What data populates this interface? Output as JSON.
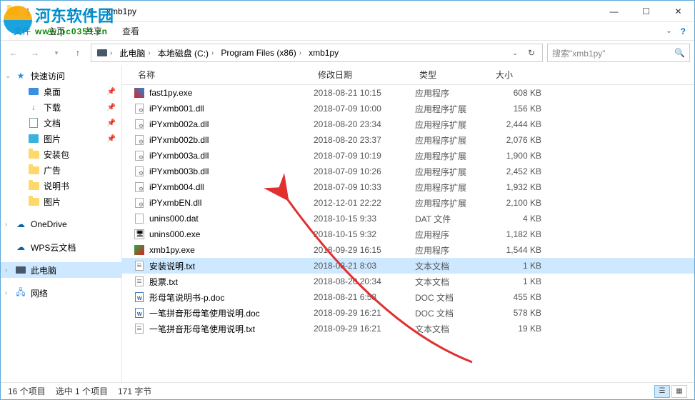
{
  "window": {
    "title": "xmb1py"
  },
  "ribbon": {
    "file": "文件",
    "tabs": [
      "主页",
      "共享",
      "查看"
    ]
  },
  "watermark": {
    "text": "河东软件园",
    "url": "www.pc0359.cn"
  },
  "address": {
    "segments": [
      "此电脑",
      "本地磁盘 (C:)",
      "Program Files (x86)",
      "xmb1py"
    ],
    "search_placeholder": "搜索\"xmb1py\""
  },
  "nav": {
    "quick": "快速访问",
    "desktop": "桌面",
    "downloads": "下载",
    "documents": "文档",
    "pictures": "图片",
    "folders": [
      "安装包",
      "广告",
      "说明书",
      "图片"
    ],
    "onedrive": "OneDrive",
    "wps": "WPS云文档",
    "thispc": "此电脑",
    "network": "网络"
  },
  "cols": {
    "name": "名称",
    "date": "修改日期",
    "type": "类型",
    "size": "大小"
  },
  "files": [
    {
      "ic": "exe1",
      "name": "fast1py.exe",
      "date": "2018-08-21 10:15",
      "type": "应用程序",
      "size": "608 KB"
    },
    {
      "ic": "dll",
      "name": "iPYxmb001.dll",
      "date": "2018-07-09 10:00",
      "type": "应用程序扩展",
      "size": "156 KB"
    },
    {
      "ic": "dll",
      "name": "iPYxmb002a.dll",
      "date": "2018-08-20 23:34",
      "type": "应用程序扩展",
      "size": "2,444 KB"
    },
    {
      "ic": "dll",
      "name": "iPYxmb002b.dll",
      "date": "2018-08-20 23:37",
      "type": "应用程序扩展",
      "size": "2,076 KB"
    },
    {
      "ic": "dll",
      "name": "iPYxmb003a.dll",
      "date": "2018-07-09 10:19",
      "type": "应用程序扩展",
      "size": "1,900 KB"
    },
    {
      "ic": "dll",
      "name": "iPYxmb003b.dll",
      "date": "2018-07-09 10:26",
      "type": "应用程序扩展",
      "size": "2,452 KB"
    },
    {
      "ic": "dll",
      "name": "iPYxmb004.dll",
      "date": "2018-07-09 10:33",
      "type": "应用程序扩展",
      "size": "1,932 KB"
    },
    {
      "ic": "dll",
      "name": "iPYxmbEN.dll",
      "date": "2012-12-01 22:22",
      "type": "应用程序扩展",
      "size": "2,100 KB"
    },
    {
      "ic": "dat",
      "name": "unins000.dat",
      "date": "2018-10-15 9:33",
      "type": "DAT 文件",
      "size": "4 KB"
    },
    {
      "ic": "exe2",
      "name": "unins000.exe",
      "date": "2018-10-15 9:32",
      "type": "应用程序",
      "size": "1,182 KB"
    },
    {
      "ic": "exe3",
      "name": "xmb1py.exe",
      "date": "2018-09-29 16:15",
      "type": "应用程序",
      "size": "1,544 KB"
    },
    {
      "ic": "txt",
      "name": "安装说明.txt",
      "date": "2018-08-21 8:03",
      "type": "文本文档",
      "size": "1 KB",
      "sel": true
    },
    {
      "ic": "txt",
      "name": "股票.txt",
      "date": "2018-08-20 20:34",
      "type": "文本文档",
      "size": "1 KB"
    },
    {
      "ic": "doc",
      "name": "形母笔说明书-p.doc",
      "date": "2018-08-21 6:58",
      "type": "DOC 文档",
      "size": "455 KB"
    },
    {
      "ic": "doc",
      "name": "一笔拼音形母笔使用说明.doc",
      "date": "2018-09-29 16:21",
      "type": "DOC 文档",
      "size": "578 KB"
    },
    {
      "ic": "txt",
      "name": "一笔拼音形母笔使用说明.txt",
      "date": "2018-09-29 16:21",
      "type": "文本文档",
      "size": "19 KB"
    }
  ],
  "status": {
    "count": "16 个项目",
    "sel": "选中 1 个项目",
    "size": "171 字节"
  }
}
